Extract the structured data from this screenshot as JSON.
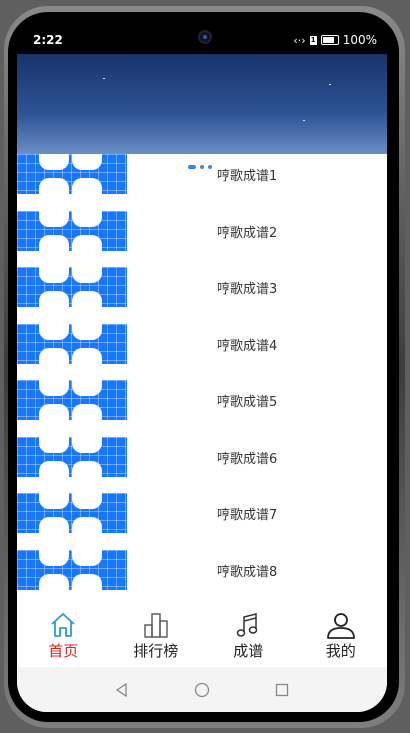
{
  "status_bar": {
    "time": "2:22",
    "battery_percent": "100%",
    "sim_label": "1",
    "icons": [
      "data-transfer-icon",
      "sim-icon",
      "battery-icon"
    ]
  },
  "banner": {
    "page_count": 3,
    "active_page": 0
  },
  "songs": [
    {
      "title": "哼歌成谱1"
    },
    {
      "title": "哼歌成谱2"
    },
    {
      "title": "哼歌成谱3"
    },
    {
      "title": "哼歌成谱4"
    },
    {
      "title": "哼歌成谱5"
    },
    {
      "title": "哼歌成谱6"
    },
    {
      "title": "哼歌成谱7"
    },
    {
      "title": "哼歌成谱8"
    }
  ],
  "tabs": [
    {
      "label": "首页",
      "icon": "home-icon",
      "active": true
    },
    {
      "label": "排行榜",
      "icon": "ranking-chart-icon",
      "active": false
    },
    {
      "label": "成谱",
      "icon": "music-note-icon",
      "active": false
    },
    {
      "label": "我的",
      "icon": "user-icon",
      "active": false
    }
  ],
  "nav_bar": {
    "icons": [
      "back-icon",
      "home-circle-icon",
      "recents-icon"
    ]
  },
  "colors": {
    "accent_active": "#e0201b",
    "thumb_blue": "#1877ff",
    "tab_icon_active": "#2a9ad8"
  }
}
